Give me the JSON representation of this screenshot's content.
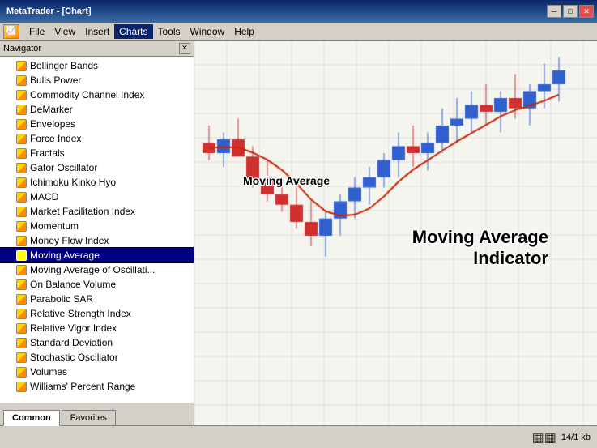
{
  "window": {
    "title": "MetaTrader - [Chart]",
    "min_btn": "─",
    "max_btn": "□",
    "close_btn": "✕"
  },
  "menu": {
    "icon_text": "📊",
    "items": [
      {
        "label": "File",
        "active": false
      },
      {
        "label": "View",
        "active": false
      },
      {
        "label": "Insert",
        "active": false
      },
      {
        "label": "Charts",
        "active": true
      },
      {
        "label": "Tools",
        "active": false
      },
      {
        "label": "Window",
        "active": false
      },
      {
        "label": "Help",
        "active": false
      }
    ]
  },
  "navigator": {
    "title": "Navigator",
    "indicators": [
      {
        "label": "Bollinger Bands"
      },
      {
        "label": "Bulls Power"
      },
      {
        "label": "Commodity Channel Index"
      },
      {
        "label": "DeMarker"
      },
      {
        "label": "Envelopes"
      },
      {
        "label": "Force Index"
      },
      {
        "label": "Fractals"
      },
      {
        "label": "Gator Oscillator"
      },
      {
        "label": "Ichimoku Kinko Hyo"
      },
      {
        "label": "MACD"
      },
      {
        "label": "Market Facilitation Index"
      },
      {
        "label": "Momentum"
      },
      {
        "label": "Money Flow Index"
      },
      {
        "label": "Moving Average",
        "selected": true
      },
      {
        "label": "Moving Average of Oscillati..."
      },
      {
        "label": "On Balance Volume"
      },
      {
        "label": "Parabolic SAR"
      },
      {
        "label": "Relative Strength Index"
      },
      {
        "label": "Relative Vigor Index"
      },
      {
        "label": "Standard Deviation"
      },
      {
        "label": "Stochastic Oscillator"
      },
      {
        "label": "Volumes"
      },
      {
        "label": "Williams' Percent Range"
      }
    ],
    "tabs": [
      {
        "label": "Common",
        "active": true
      },
      {
        "label": "Favorites",
        "active": false
      }
    ]
  },
  "chart": {
    "label_moving_avg": "Moving Average",
    "label_indicator_line1": "Moving Average",
    "label_indicator_line2": "Indicator"
  },
  "status": {
    "size_info": "14/1 kb"
  }
}
